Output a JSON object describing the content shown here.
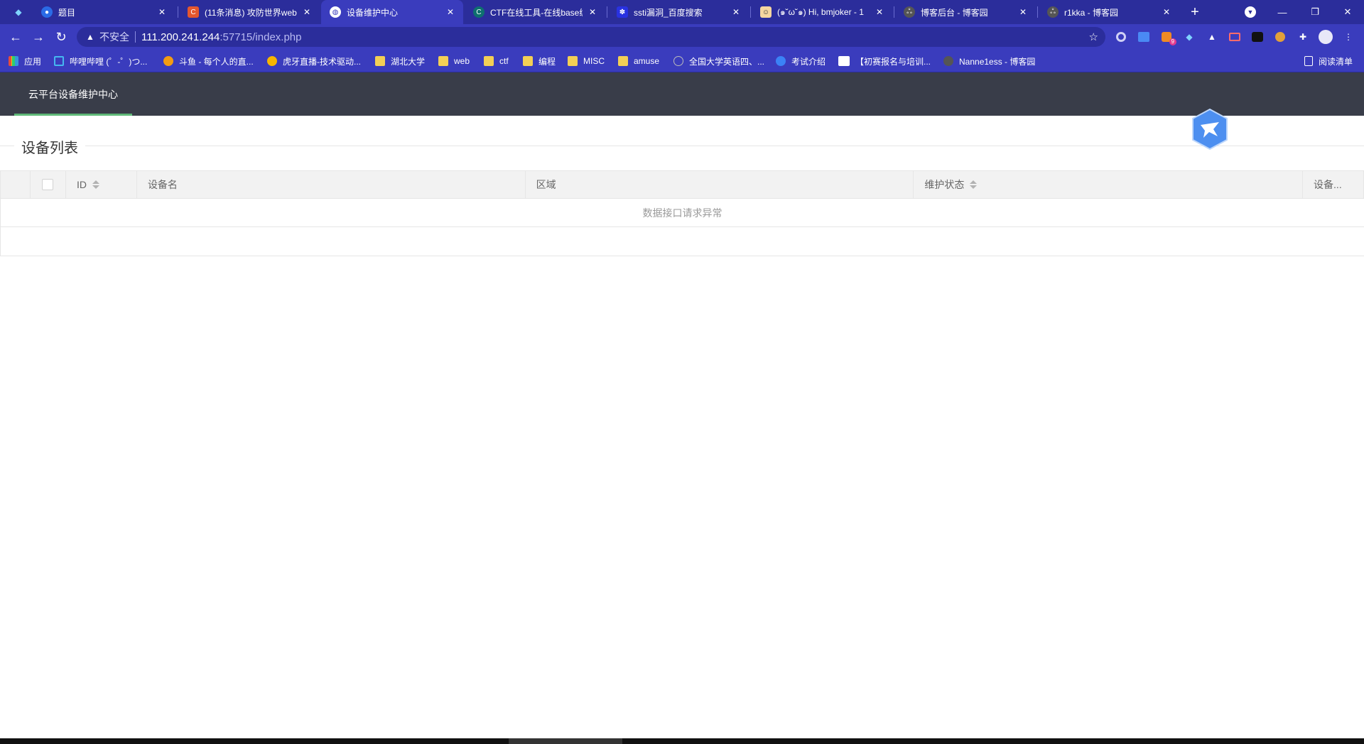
{
  "browser": {
    "tabs": [
      {
        "title": "题目",
        "favicon_color": "#2b6be6"
      },
      {
        "title": "(11条消息) 攻防世界web",
        "favicon_color": "#e4572e"
      },
      {
        "title": "设备维护中心",
        "favicon_color": "#ffffff",
        "active": true
      },
      {
        "title": "CTF在线工具-在线base编",
        "favicon_color": "#1ba4a4"
      },
      {
        "title": "ssti漏洞_百度搜索",
        "favicon_color": "#2932e1"
      },
      {
        "title": "(๑˘ω˘๑) Hi, bmjoker - 1",
        "favicon_color": "#f5d6a0"
      },
      {
        "title": "博客后台 - 博客园",
        "favicon_color": "#555555"
      },
      {
        "title": "r1kka - 博客园",
        "favicon_color": "#555555"
      }
    ],
    "address": {
      "security_label": "不安全",
      "host": "111.200.241.244",
      "path": ":57715/index.php"
    },
    "bookmarks": [
      {
        "label": "应用",
        "icon": "apps-grid-icon"
      },
      {
        "label": "哔哩哔哩 (゜-゜)つ...",
        "icon": "bilibili-icon"
      },
      {
        "label": "斗鱼 - 每个人的直...",
        "icon": "douyu-icon"
      },
      {
        "label": "虎牙直播-技术驱动...",
        "icon": "huya-icon"
      },
      {
        "label": "湖北大学",
        "icon": "folder-icon"
      },
      {
        "label": "web",
        "icon": "folder-icon"
      },
      {
        "label": "ctf",
        "icon": "folder-icon"
      },
      {
        "label": "编程",
        "icon": "folder-icon"
      },
      {
        "label": "MISC",
        "icon": "folder-icon"
      },
      {
        "label": "amuse",
        "icon": "folder-icon"
      },
      {
        "label": "全国大学英语四、...",
        "icon": "cet-icon"
      },
      {
        "label": "考试介绍",
        "icon": "exam-icon"
      },
      {
        "label": "【初赛报名与培训...",
        "icon": "contest-icon"
      },
      {
        "label": "Nanne1ess - 博客园",
        "icon": "cnblogs-icon"
      }
    ],
    "reading_list": "阅读清单",
    "extension_badge": "9"
  },
  "app": {
    "header_nav": "云平台设备维护中心",
    "section_title": "设备列表",
    "table": {
      "columns": [
        "ID",
        "设备名",
        "区域",
        "维护状态",
        "设备..."
      ],
      "empty_text": "数据接口请求异常"
    }
  },
  "colors": {
    "header_bg": "#393d49",
    "nav_active_bar": "#5fb878",
    "browser_tab_bg": "#2b2d9b"
  }
}
